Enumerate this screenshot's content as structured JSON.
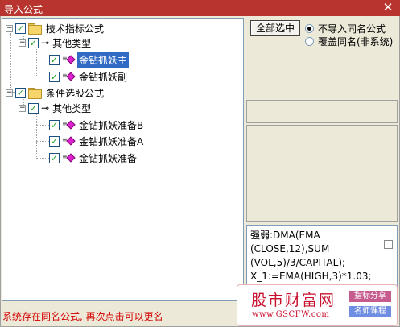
{
  "window": {
    "title": "导入公式",
    "close_glyph": "✕"
  },
  "tree": {
    "groups": [
      {
        "label": "技术指标公式",
        "checked": true,
        "subgroup": {
          "label": "其他类型",
          "items": [
            {
              "label": "金钻抓妖主",
              "selected": true
            },
            {
              "label": "金钻抓妖副",
              "selected": false
            }
          ]
        }
      },
      {
        "label": "条件选股公式",
        "checked": true,
        "subgroup": {
          "label": "其他类型",
          "items": [
            {
              "label": "金钻抓妖准备B",
              "selected": false
            },
            {
              "label": "金钻抓妖准备A",
              "selected": false
            },
            {
              "label": "金钻抓妖准备",
              "selected": false
            }
          ]
        }
      }
    ]
  },
  "controls": {
    "select_all_label": "全部选中",
    "radio_options": [
      {
        "label": "不导入同名公式",
        "selected": true
      },
      {
        "label": "覆盖同名(非系统)",
        "selected": false
      }
    ]
  },
  "formula_preview": {
    "lines": [
      "强弱:DMA(EMA",
      "(CLOSE,12),SUM",
      "(VOL,5)/3/CAPITAL);",
      "X_1:=EMA(HIGH,3)*1.03;"
    ]
  },
  "status": {
    "message": "系统存在同名公式, 再次点击可以更名"
  },
  "watermark": {
    "brand": "股市财富网",
    "url": "www.GSCFW.com",
    "tag_1": "指标分享",
    "tag_2": "名师课程"
  },
  "colors": {
    "titlebar": "#b8352f",
    "selection": "#316ac5",
    "status_text": "#d40000",
    "checkmark": "#21a121",
    "formula_gem": "#e01fd0"
  }
}
